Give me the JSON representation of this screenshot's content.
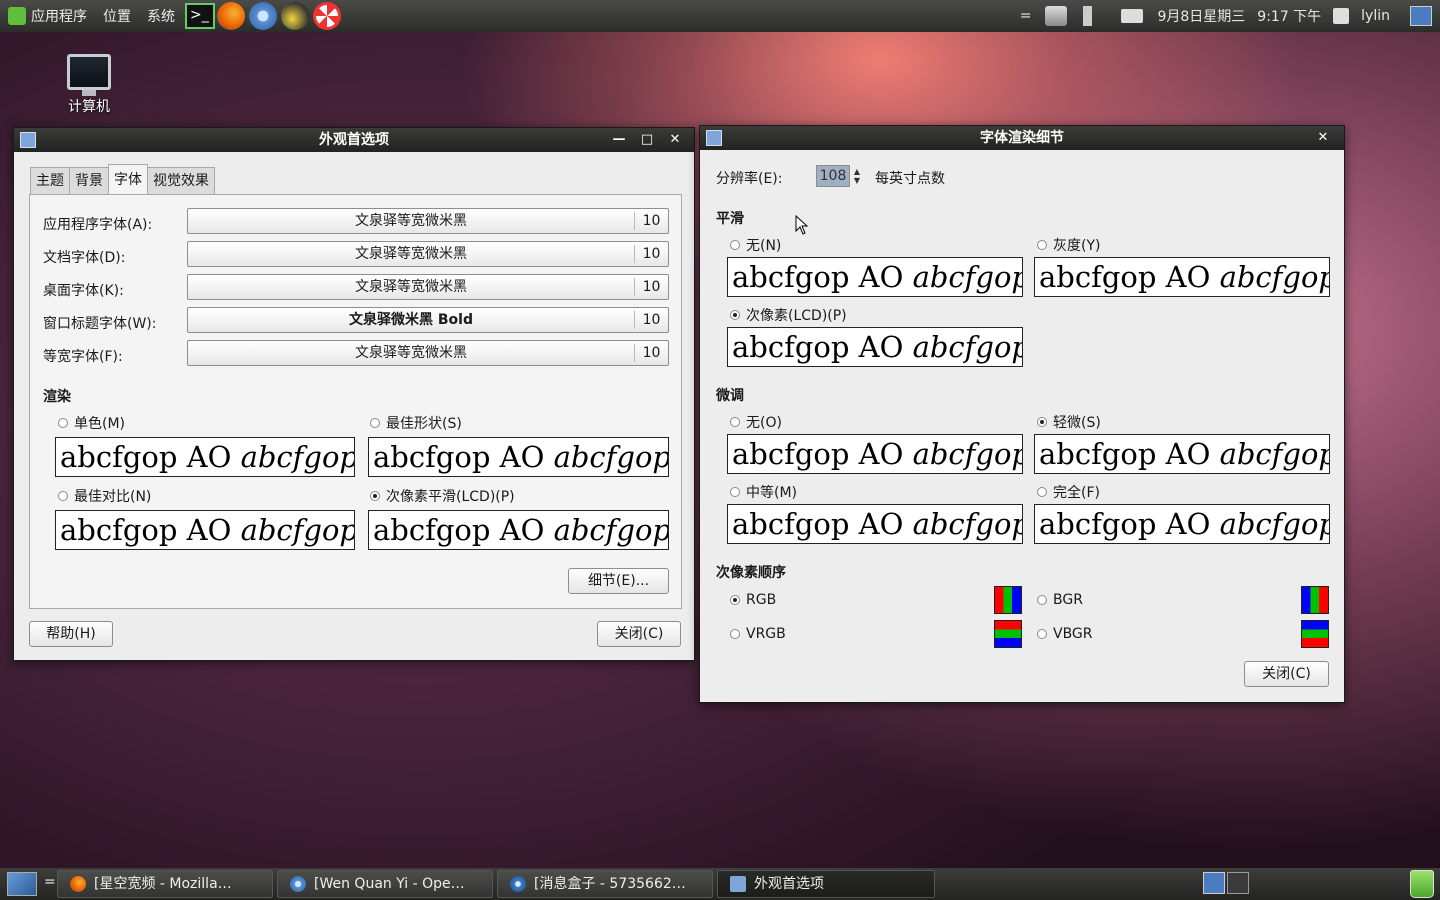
{
  "top_panel": {
    "menus": [
      "应用程序",
      "位置",
      "系统"
    ],
    "quick_launch": [
      "terminal-icon",
      "firefox-icon",
      "chromium-icon",
      "banana-icon",
      "lifebuoy-icon"
    ],
    "tray": [
      "network-icon",
      "volume-icon",
      "mail-icon"
    ],
    "clock_date": "9月8日星期三",
    "clock_time": "9:17 下午",
    "user": "lylin",
    "menu_toggle": "="
  },
  "desktop": {
    "computer_label": "计算机"
  },
  "appearance_window": {
    "title": "外观首选项",
    "tabs": [
      "主题",
      "背景",
      "字体",
      "视觉效果"
    ],
    "active_tab": "字体",
    "font_rows": [
      {
        "label": "应用程序字体(A):",
        "font": "文泉驿等宽微米黑",
        "size": "10"
      },
      {
        "label": "文档字体(D):",
        "font": "文泉驿等宽微米黑",
        "size": "10"
      },
      {
        "label": "桌面字体(K):",
        "font": "文泉驿等宽微米黑",
        "size": "10"
      },
      {
        "label": "窗口标题字体(W):",
        "font": "文泉驿微米黑 Bold",
        "size": "10"
      },
      {
        "label": "等宽字体(F):",
        "font": "文泉驿等宽微米黑",
        "size": "10"
      }
    ],
    "render_heading": "渲染",
    "render_options": [
      {
        "label": "单色(M)",
        "selected": false
      },
      {
        "label": "最佳形状(S)",
        "selected": false
      },
      {
        "label": "最佳对比(N)",
        "selected": false
      },
      {
        "label": "次像素平滑(LCD)(P)",
        "selected": true
      }
    ],
    "sample_text": "abcfgop AO ",
    "sample_italic": "abcfgop",
    "details_button": "细节(E)...",
    "help_button": "帮助(H)",
    "close_button": "关闭(C)"
  },
  "details_window": {
    "title": "字体渲染细节",
    "resolution_label": "分辨率(E):",
    "resolution_value": "108",
    "resolution_unit": "每英寸点数",
    "smoothing_heading": "平滑",
    "smoothing_options": [
      {
        "label": "无(N)",
        "selected": false
      },
      {
        "label": "灰度(Y)",
        "selected": false
      },
      {
        "label": "次像素(LCD)(P)",
        "selected": true
      }
    ],
    "hinting_heading": "微调",
    "hinting_options": [
      {
        "label": "无(O)",
        "selected": false
      },
      {
        "label": "轻微(S)",
        "selected": true
      },
      {
        "label": "中等(M)",
        "selected": false
      },
      {
        "label": "完全(F)",
        "selected": false
      }
    ],
    "order_heading": "次像素顺序",
    "order_options": [
      {
        "label": "RGB",
        "selected": true
      },
      {
        "label": "BGR",
        "selected": false
      },
      {
        "label": "VRGB",
        "selected": false
      },
      {
        "label": "VBGR",
        "selected": false
      }
    ],
    "close_button": "关闭(C)"
  },
  "taskbar": {
    "menu_toggle": "=",
    "tasks": [
      "[星空宽频 - Mozilla…",
      "[Wen Quan Yi - Ope…",
      "[消息盒子 - 5735662…",
      "外观首选项"
    ]
  },
  "colors": {
    "red": "#ff0000",
    "green": "#00c000",
    "blue": "#0000ff"
  }
}
